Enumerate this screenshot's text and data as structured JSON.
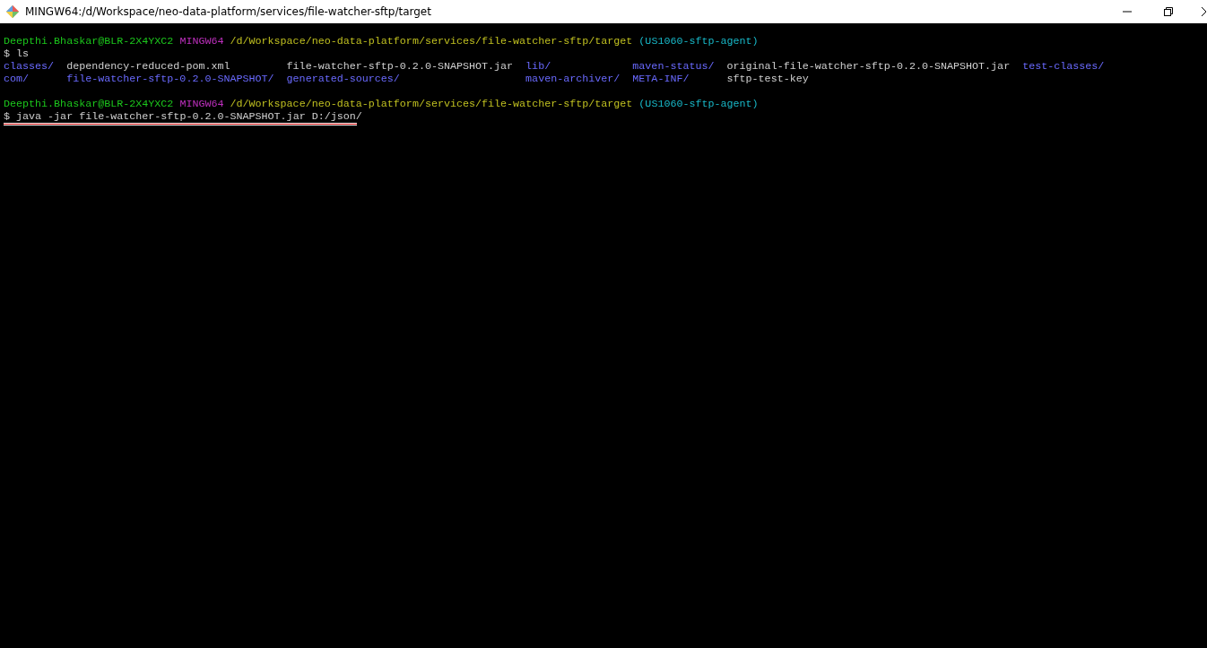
{
  "window": {
    "title": "MINGW64:/d/Workspace/neo-data-platform/services/file-watcher-sftp/target"
  },
  "lines": [
    {
      "kind": "prompt",
      "user": "Deepthi.Bhaskar@BLR-2X4YXC2",
      "shell": "MINGW64",
      "path": "/d/Workspace/neo-data-platform/services/file-watcher-sftp/target",
      "branch": "(US1060-sftp-agent)"
    },
    {
      "kind": "command",
      "text": "$ ls"
    },
    {
      "kind": "listing",
      "rows": [
        [
          {
            "name": "classes/",
            "kind": "dir"
          },
          {
            "name": "dependency-reduced-pom.xml",
            "kind": "file"
          },
          {
            "name": "file-watcher-sftp-0.2.0-SNAPSHOT.jar",
            "kind": "file"
          },
          {
            "name": "lib/",
            "kind": "dir"
          },
          {
            "name": "maven-status/",
            "kind": "dir"
          },
          {
            "name": "original-file-watcher-sftp-0.2.0-SNAPSHOT.jar",
            "kind": "file"
          },
          {
            "name": "test-classes/",
            "kind": "dir"
          }
        ],
        [
          {
            "name": "com/",
            "kind": "dir"
          },
          {
            "name": "file-watcher-sftp-0.2.0-SNAPSHOT/",
            "kind": "dir"
          },
          {
            "name": "generated-sources/",
            "kind": "dir"
          },
          {
            "name": "maven-archiver/",
            "kind": "dir"
          },
          {
            "name": "META-INF/",
            "kind": "dir"
          },
          {
            "name": "sftp-test-key",
            "kind": "file"
          }
        ]
      ]
    },
    {
      "kind": "blank"
    },
    {
      "kind": "prompt",
      "user": "Deepthi.Bhaskar@BLR-2X4YXC2",
      "shell": "MINGW64",
      "path": "/d/Workspace/neo-data-platform/services/file-watcher-sftp/target",
      "branch": "(US1060-sftp-agent)"
    },
    {
      "kind": "command",
      "text": "$ java -jar file-watcher-sftp-0.2.0-SNAPSHOT.jar D:/json/"
    }
  ]
}
